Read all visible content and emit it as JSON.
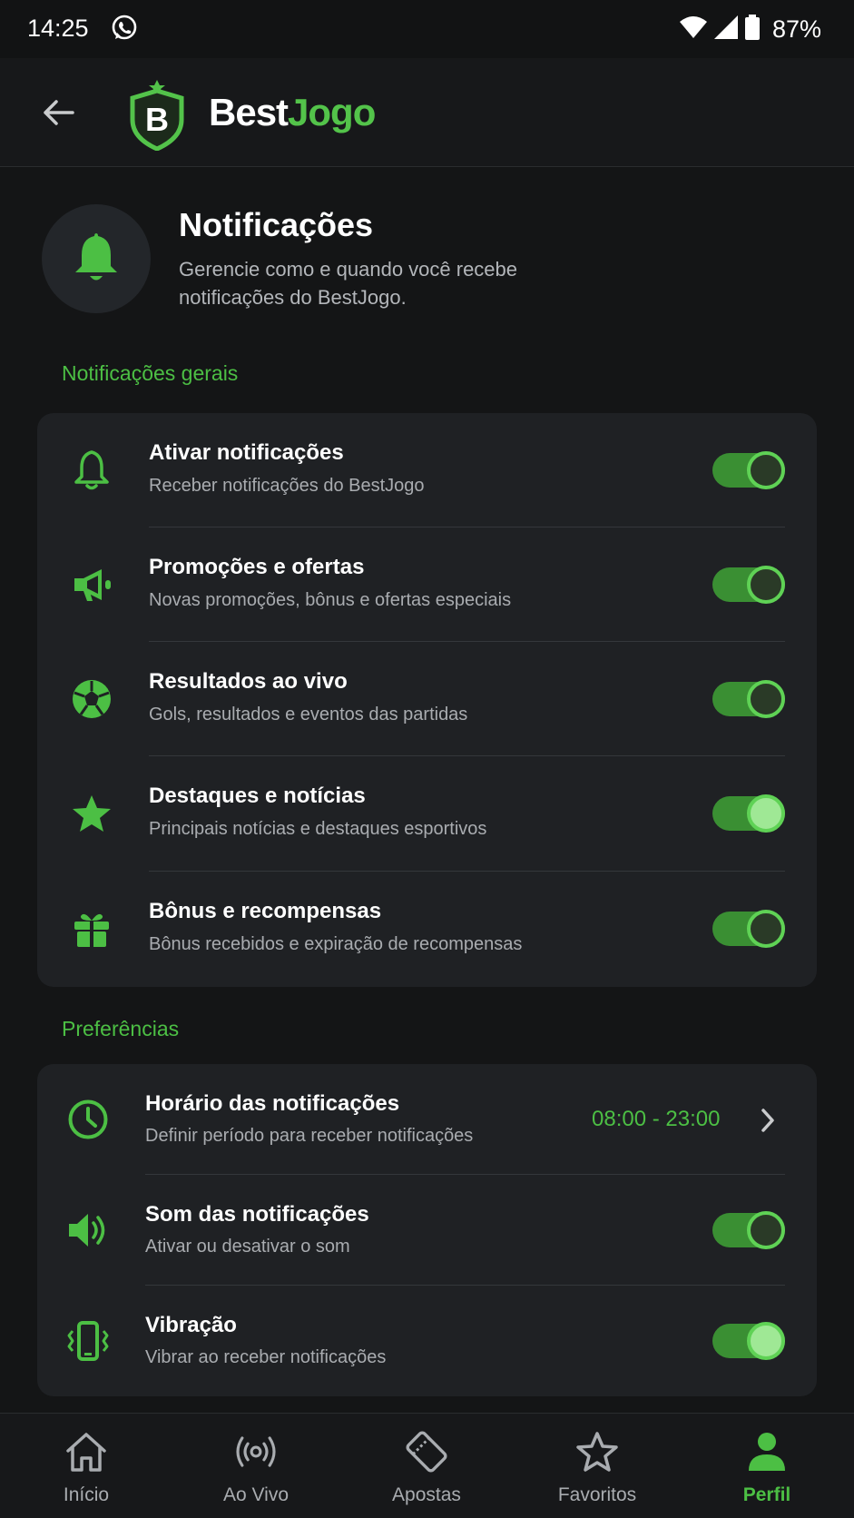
{
  "status_bar": {
    "time": "14:25",
    "battery": "87%",
    "icons": [
      "whatsapp-icon",
      "wifi-icon",
      "signal-icon",
      "battery-icon"
    ]
  },
  "header": {
    "logo_part1": "Best",
    "logo_part2": "Jogo",
    "logo_letter": "B"
  },
  "intro": {
    "title": "Notificações",
    "description": "Gerencie como e quando você recebe notificações do BestJogo."
  },
  "general": {
    "section_title": "Notificações gerais",
    "items": [
      {
        "title": "Ativar notificações",
        "subtitle": "Receber notificações do BestJogo",
        "icon": "bell-icon",
        "enabled": true
      },
      {
        "title": "Promoções e ofertas",
        "subtitle": "Novas promoções, bônus e ofertas especiais",
        "icon": "megaphone-icon",
        "enabled": true
      },
      {
        "title": "Resultados ao vivo",
        "subtitle": "Gols, resultados e eventos das partidas",
        "icon": "soccer-ball-icon",
        "enabled": true
      },
      {
        "title": "Destaques e notícias",
        "subtitle": "Principais notícias e destaques esportivos",
        "icon": "star-icon",
        "enabled": true
      },
      {
        "title": "Bônus e recompensas",
        "subtitle": "Bônus recebidos e expiração de recompensas",
        "icon": "gift-icon",
        "enabled": true
      }
    ]
  },
  "preferences": {
    "section_title": "Preferências",
    "schedule": {
      "title": "Horário das notificações",
      "subtitle": "Definir período para receber notificações",
      "value": "08:00 - 23:00",
      "icon": "clock-icon"
    },
    "sound": {
      "title": "Som das notificações",
      "subtitle": "Ativar ou desativar o som",
      "icon": "speaker-icon",
      "enabled": true
    },
    "vibration": {
      "title": "Vibração",
      "subtitle": "Vibrar ao receber notificações",
      "icon": "vibration-icon",
      "enabled": true
    }
  },
  "nav": {
    "items": [
      {
        "label": "Início",
        "icon": "home-icon"
      },
      {
        "label": "Ao Vivo",
        "icon": "broadcast-icon"
      },
      {
        "label": "Apostas",
        "icon": "ticket-icon"
      },
      {
        "label": "Favoritos",
        "icon": "star-outline-icon"
      },
      {
        "label": "Perfil",
        "icon": "person-icon",
        "active": true
      }
    ]
  },
  "colors": {
    "accent": "#4cbf44",
    "background": "#141516",
    "card": "#1f2124"
  }
}
